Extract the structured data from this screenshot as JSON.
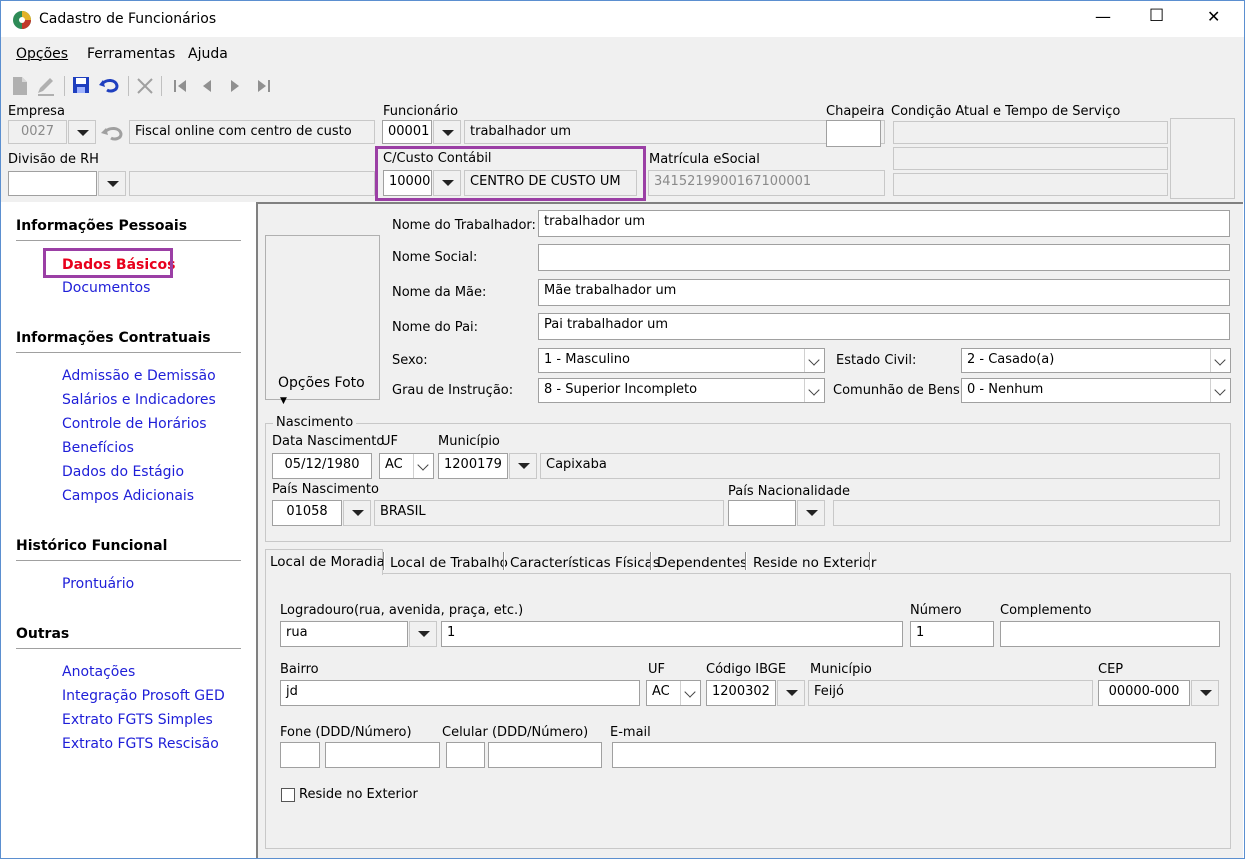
{
  "window": {
    "title": "Cadastro de Funcionários",
    "minimize": "—",
    "maximize": "☐",
    "close": "✕"
  },
  "menu": {
    "opcoes": "Opções",
    "ferramentas": "Ferramentas",
    "ajuda": "Ajuda"
  },
  "header": {
    "empresa_label": "Empresa",
    "empresa_code": "0027",
    "empresa_name": "Fiscal online com centro de custo",
    "funcionario_label": "Funcionário",
    "funcionario_code": "00001",
    "funcionario_name": "trabalhador um",
    "chapeira_label": "Chapeira",
    "chapeira_value": "",
    "condicao_label": "Condição Atual e Tempo de Serviço",
    "divisao_label": "Divisão de RH",
    "divisao_code": "",
    "divisao_name": "",
    "ccusto_label": "C/Custo Contábil",
    "ccusto_code": "10000",
    "ccusto_name": "CENTRO DE CUSTO UM",
    "matricula_label": "Matrícula eSocial",
    "matricula_value": "3415219900167100001"
  },
  "sidebar": {
    "sections": [
      {
        "title": "Informações Pessoais",
        "items": [
          "Dados Básicos",
          "Documentos"
        ]
      },
      {
        "title": "Informações Contratuais",
        "items": [
          "Admissão e Demissão",
          "Salários e Indicadores",
          "Controle de Horários",
          "Benefícios",
          "Dados do Estágio",
          "Campos Adicionais"
        ]
      },
      {
        "title": "Histórico Funcional",
        "items": [
          "Prontuário"
        ]
      },
      {
        "title": "Outras",
        "items": [
          "Anotações",
          "Integração Prosoft GED",
          "Extrato FGTS Simples",
          "Extrato FGTS Rescisão"
        ]
      }
    ],
    "selected": "Dados Básicos",
    "selected_color": "#e8001c",
    "link_color": "#1e1ed8",
    "highlight_color": "#9b3fa5"
  },
  "basic": {
    "opcoes_foto": "Opções Foto",
    "nome_trab_label": "Nome do Trabalhador:",
    "nome_trab": "trabalhador um",
    "nome_social_label": "Nome Social:",
    "nome_social": "",
    "nome_mae_label": "Nome da Mãe:",
    "nome_mae": "Mãe trabalhador um",
    "nome_pai_label": "Nome do Pai:",
    "nome_pai": "Pai trabalhador um",
    "sexo_label": "Sexo:",
    "sexo": "1 - Masculino",
    "estado_civil_label": "Estado Civil:",
    "estado_civil": "2 - Casado(a)",
    "grau_label": "Grau de Instrução:",
    "grau": "8 - Superior Incompleto",
    "comunhao_label": "Comunhão de Bens:",
    "comunhao": "0 - Nenhum"
  },
  "nascimento": {
    "group_label": "Nascimento",
    "data_label": "Data Nascimento",
    "data": "05/12/1980",
    "uf_label": "UF",
    "uf": "AC",
    "municipio_label": "Município",
    "municipio_code": "1200179",
    "municipio_name": "Capixaba",
    "pais_label": "País Nascimento",
    "pais_code": "01058",
    "pais_name": "BRASIL",
    "nacionalidade_label": "País Nacionalidade",
    "nacionalidade_code": "",
    "nacionalidade_name": ""
  },
  "tabs": [
    "Local de Moradia",
    "Local de Trabalho",
    "Características Físicas",
    "Dependentes",
    "Reside no Exterior"
  ],
  "moradia": {
    "logradouro_label": "Logradouro(rua, avenida, praça, etc.)",
    "logradouro_tipo": "rua",
    "logradouro": "1",
    "numero_label": "Número",
    "numero": "1",
    "complemento_label": "Complemento",
    "complemento": "",
    "bairro_label": "Bairro",
    "bairro": "jd",
    "uf_label": "UF",
    "uf": "AC",
    "ibge_label": "Código IBGE",
    "ibge": "1200302",
    "municipio_label": "Município",
    "municipio": "Feijó",
    "cep_label": "CEP",
    "cep": "00000-000",
    "fone_label": "Fone (DDD/Número)",
    "celular_label": "Celular (DDD/Número)",
    "email_label": "E-mail",
    "reside_exterior_label": "Reside no Exterior"
  }
}
